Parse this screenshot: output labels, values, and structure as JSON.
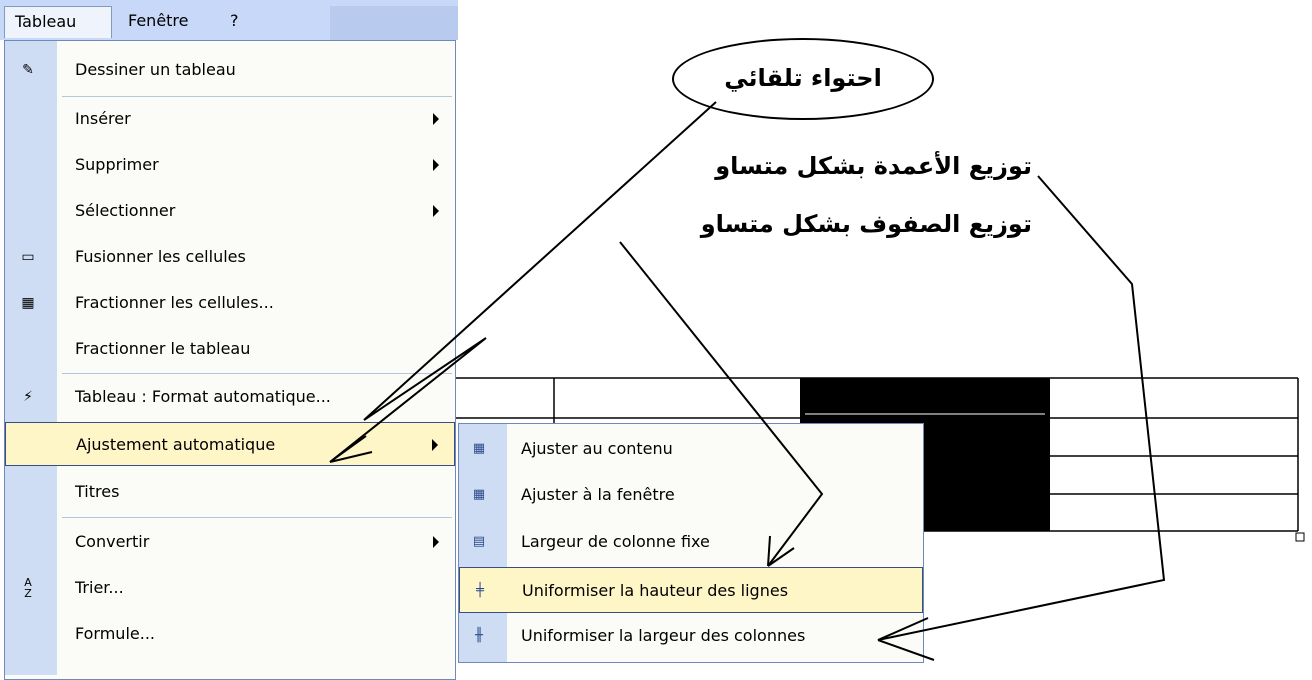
{
  "menubar": {
    "items": [
      "Tableau",
      "Fenêtre",
      "?"
    ]
  },
  "menu": {
    "items": [
      {
        "label": "Dessiner un tableau",
        "icon": "pencil-table-icon",
        "submenu": false
      },
      {
        "label": "Insérer",
        "icon": "",
        "submenu": true
      },
      {
        "label": "Supprimer",
        "icon": "",
        "submenu": true
      },
      {
        "label": "Sélectionner",
        "icon": "",
        "submenu": true
      },
      {
        "label": "Fusionner les cellules",
        "icon": "merge-cells-icon",
        "submenu": false
      },
      {
        "label": "Fractionner les cellules...",
        "icon": "split-cells-icon",
        "submenu": false
      },
      {
        "label": "Fractionner le tableau",
        "icon": "",
        "submenu": false
      },
      {
        "label": "Tableau : Format automatique...",
        "icon": "autoformat-icon",
        "submenu": false
      },
      {
        "label": "Ajustement automatique",
        "icon": "",
        "submenu": true,
        "highlighted": true
      },
      {
        "label": "Titres",
        "icon": "",
        "submenu": false
      },
      {
        "label": "Convertir",
        "icon": "",
        "submenu": true
      },
      {
        "label": "Trier...",
        "icon": "sort-az-icon",
        "submenu": false
      },
      {
        "label": "Formule...",
        "icon": "",
        "submenu": false
      }
    ]
  },
  "submenu": {
    "items": [
      {
        "label": "Ajuster au contenu",
        "icon": "autofit-contents-icon"
      },
      {
        "label": "Ajuster à la fenêtre",
        "icon": "autofit-window-icon"
      },
      {
        "label": "Largeur de colonne fixe",
        "icon": "fixed-width-icon"
      },
      {
        "label": "Uniformiser la hauteur des lignes",
        "icon": "distribute-rows-icon",
        "highlighted": true
      },
      {
        "label": "Uniformiser la largeur des colonnes",
        "icon": "distribute-columns-icon"
      }
    ]
  },
  "annotations": {
    "oval_label": "احتواء تلقائي",
    "line1": "توزيع الأعمدة بشكل متساو",
    "line2": "توزيع الصفوف بشكل متساو"
  },
  "colors": {
    "menu_strip": "#cfddf4",
    "highlight": "#fff6c8",
    "menubar": "#c8d8f8"
  }
}
